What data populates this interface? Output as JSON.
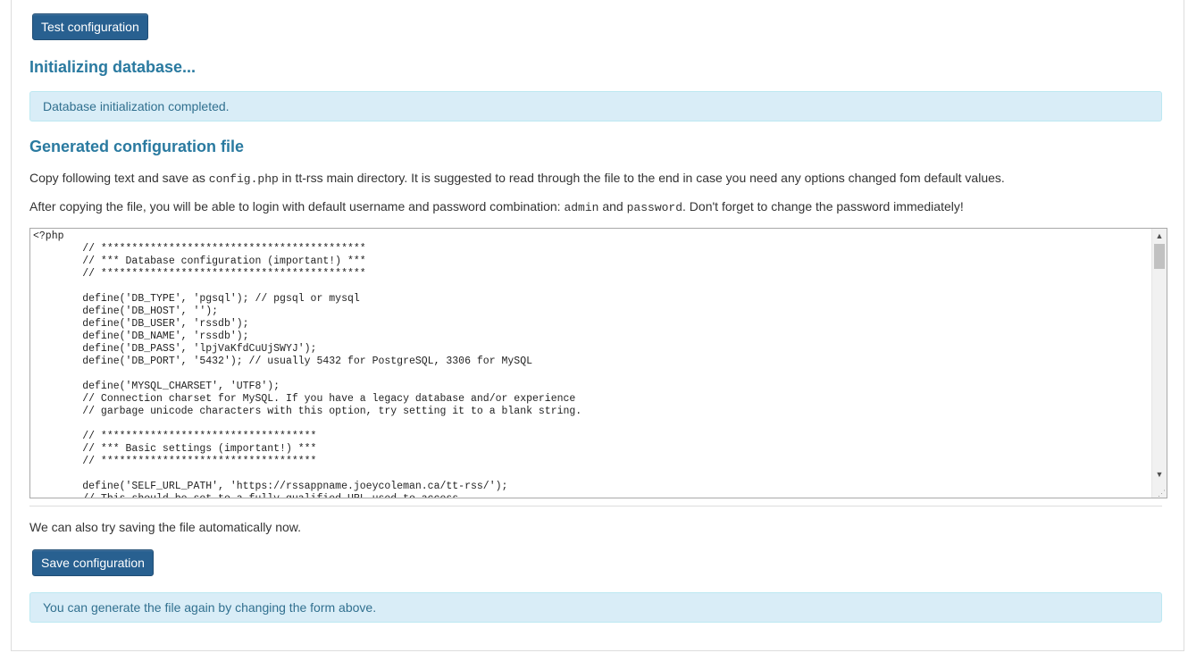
{
  "buttons": {
    "test_configuration": "Test configuration",
    "save_configuration": "Save configuration"
  },
  "init": {
    "heading": "Initializing database...",
    "alert": "Database initialization completed."
  },
  "config": {
    "heading": "Generated configuration file",
    "copy_prefix": "Copy following text and save as ",
    "copy_code": "config.php",
    "copy_suffix": " in tt-rss main directory. It is suggested to read through the file to the end in case you need any options changed fom default values.",
    "login_prefix": "After copying the file, you will be able to login with default username and password combination: ",
    "login_user": "admin",
    "login_and": " and ",
    "login_pass": "password",
    "login_suffix": ". Don't forget to change the password immediately!",
    "file_text": "<?php\n\t// *******************************************\n\t// *** Database configuration (important!) ***\n\t// *******************************************\n\n\tdefine('DB_TYPE', 'pgsql'); // pgsql or mysql\n\tdefine('DB_HOST', '');\n\tdefine('DB_USER', 'rssdb');\n\tdefine('DB_NAME', 'rssdb');\n\tdefine('DB_PASS', 'lpjVaKfdCuUjSWYJ');\n\tdefine('DB_PORT', '5432'); // usually 5432 for PostgreSQL, 3306 for MySQL\n\n\tdefine('MYSQL_CHARSET', 'UTF8');\n\t// Connection charset for MySQL. If you have a legacy database and/or experience\n\t// garbage unicode characters with this option, try setting it to a blank string.\n\n\t// ***********************************\n\t// *** Basic settings (important!) ***\n\t// ***********************************\n\n\tdefine('SELF_URL_PATH', 'https://rssappname.joeycoleman.ca/tt-rss/');\n\t// This should be set to a fully qualified URL used to access"
  },
  "save": {
    "text": "We can also try saving the file automatically now.",
    "alert": "You can generate the file again by changing the form above."
  },
  "icons": {
    "scroll_up": "▲",
    "scroll_down": "▼",
    "resize": "⋰"
  }
}
